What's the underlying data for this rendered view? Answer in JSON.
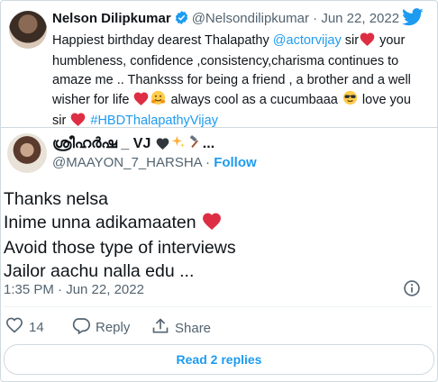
{
  "quoted": {
    "name": "Nelson Dilipkumar",
    "handle": "@Nelsondilipkumar",
    "separator": "·",
    "date": "Jun 22, 2022",
    "text_line1_a": "Happiest birthday dearest Thalapathy ",
    "mention": "@actorvijay",
    "text_line1_b": " sir",
    "text_line1_c": " your",
    "text_line2": "humbleness, confidence ,consistency,charisma continues to",
    "text_line3": "amaze me .. Thanksss for being a friend , a brother and a well",
    "text_line4_a": "wisher for life ",
    "text_line4_b": " always cool as a cucumbaaa ",
    "text_line4_c": " love you",
    "text_line5_a": "sir ",
    "hashtag": "#HBDThalapathyVijay"
  },
  "reply": {
    "name": "ശ്രീഹർഷ _ VJ",
    "handle": "@MAAYON_7_HARSHA",
    "separator": "·",
    "follow_label": "Follow",
    "lines": [
      "Thanks nelsa",
      "Inime unna adikamaaten",
      "Avoid those type of interviews",
      "Jailor aachu nalla edu ..."
    ],
    "timestamp": "1:35 PM · Jun 22, 2022",
    "likes": "14",
    "reply_label": "Reply",
    "share_label": "Share",
    "read_more_label": "Read 2 replies"
  },
  "icons": {
    "verified": "verified-badge-icon",
    "bird": "twitter-bird-icon",
    "heart": "heart-icon",
    "reply": "reply-icon",
    "share": "share-icon",
    "info": "info-icon"
  },
  "colors": {
    "accent": "#1d9bf0",
    "heart": "#e0245e",
    "text": "#0f1419",
    "muted": "#536471"
  }
}
